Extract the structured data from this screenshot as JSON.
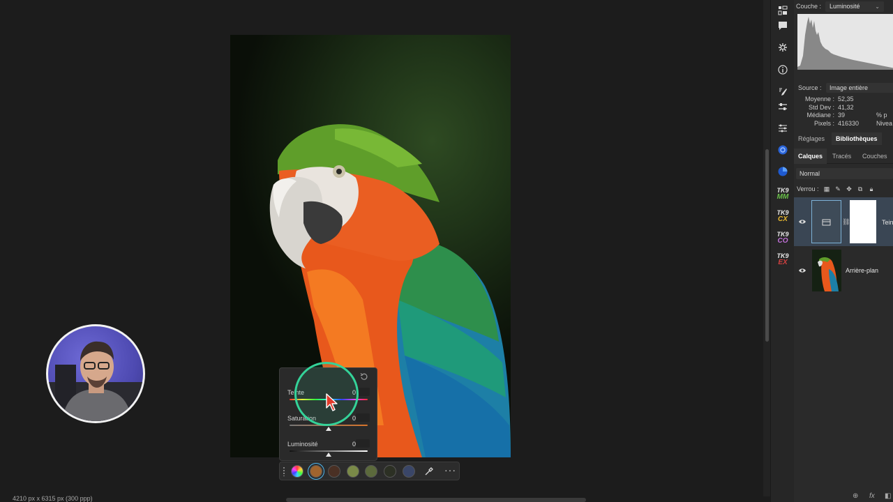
{
  "status_bar": {
    "text": "4210 px x 6315 px (300 ppp)"
  },
  "adjustment_popover": {
    "controls": [
      {
        "label": "Teinte",
        "value": "0"
      },
      {
        "label": "Saturation",
        "value": "0"
      },
      {
        "label": "Luminosité",
        "value": "0"
      }
    ]
  },
  "swatch_bar": {
    "swatches": [
      "#a0642e",
      "#4a3024",
      "#7a8a48",
      "#5c6a3c",
      "#2c3024",
      "#3a4668"
    ],
    "more_label": "···"
  },
  "tool_strip": {
    "icons": [
      "properties-icon",
      "comment-icon",
      "asterisk-icon",
      "info-icon",
      "brush-settings-icon",
      "adjustments-icon",
      "sliders-icon",
      "plugin-blue-circle-icon",
      "plugin-blue-pie-icon"
    ],
    "tk_plugins": [
      {
        "top": "TK9",
        "bottom": "MM",
        "color": "#6ac04a"
      },
      {
        "top": "TK9",
        "bottom": "CX",
        "color": "#e8b830"
      },
      {
        "top": "TK9",
        "bottom": "CO",
        "color": "#c070d8"
      },
      {
        "top": "TK9",
        "bottom": "EX",
        "color": "#d04040"
      }
    ]
  },
  "histogram_panel": {
    "channel_label": "Couche :",
    "channel_value": "Luminosité",
    "source_label": "Source :",
    "source_value": "Image entière",
    "stats": [
      {
        "key": "Moyenne :",
        "value": "52,35"
      },
      {
        "key": "Std Dev :",
        "value": "41,32"
      },
      {
        "key": "Médiane :",
        "value": "39"
      },
      {
        "key": "Pixels :",
        "value": "416330"
      }
    ],
    "stats_right": [
      "% p",
      "Nivea"
    ]
  },
  "panel_tabs_top": [
    "Réglages",
    "Bibliothèques"
  ],
  "panel_tabs_layers": [
    "Calques",
    "Tracés",
    "Couches"
  ],
  "layers_panel": {
    "blend_mode": "Normal",
    "lock_label": "Verrou :",
    "layers": [
      {
        "name": "Teinte",
        "selected": true
      },
      {
        "name": "Arrière-plan",
        "selected": false
      }
    ]
  },
  "panel_footer": {
    "link": "⊕",
    "fx": "fx"
  }
}
